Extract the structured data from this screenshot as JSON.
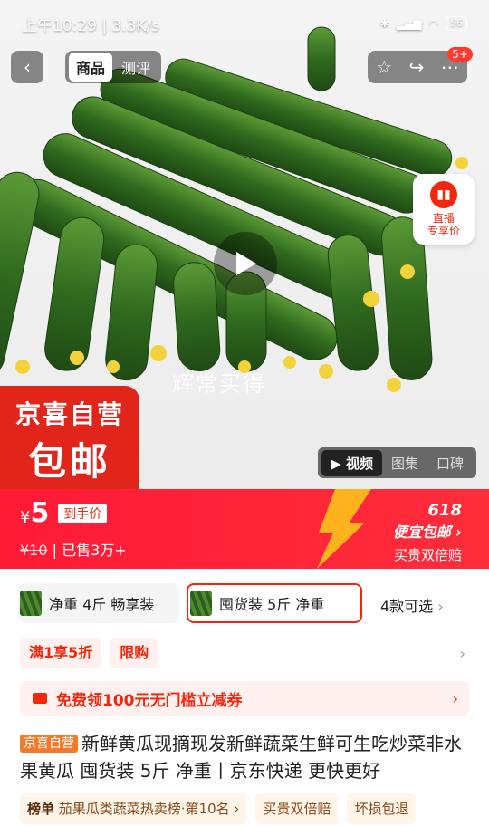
{
  "status_bar": {
    "time_speed": "上午10:29 | 3.3K/s",
    "battery": "56"
  },
  "nav": {
    "tabs": [
      {
        "label": "商品"
      },
      {
        "label": "测评"
      }
    ],
    "message_badge": "5+"
  },
  "live": {
    "label_line1": "直播",
    "label_line2": "专享价"
  },
  "watermark": "辉常买得",
  "self_badge": {
    "line1": "京喜自营",
    "line2": "包邮"
  },
  "media_tabs": [
    {
      "label": "视频"
    },
    {
      "label": "图集"
    },
    {
      "label": "口碑"
    }
  ],
  "price": {
    "currency": "¥",
    "value": "5",
    "hand_tag": "到手价",
    "original": "¥10",
    "sold": "已售3万+",
    "promo_618": "618",
    "promo_text": "便宜包邮",
    "promo_sub": "买贵双倍赔"
  },
  "specs": {
    "option1": "净重 4斤 畅享装",
    "option2": "囤货装 5斤 净重",
    "more": "4款可选"
  },
  "tags": [
    {
      "label": "满1享5折"
    },
    {
      "label": "限购"
    }
  ],
  "coupon": {
    "text": "免费领100元无门槛立减券"
  },
  "product": {
    "self_tag": "京喜自营",
    "title": "新鲜黄瓜现摘现发新鲜蔬菜生鲜可生吃炒菜非水果黄瓜 囤货装 5斤 净重丨京东快递 更快更好"
  },
  "rank": {
    "label": "榜单",
    "text": "茄果瓜类蔬菜热卖榜·第10名",
    "guarantee1": "买贵双倍赔",
    "guarantee2": "坏损包退"
  },
  "colors": {
    "accent": "#f2270c",
    "price_bar": "#ff1a36"
  }
}
